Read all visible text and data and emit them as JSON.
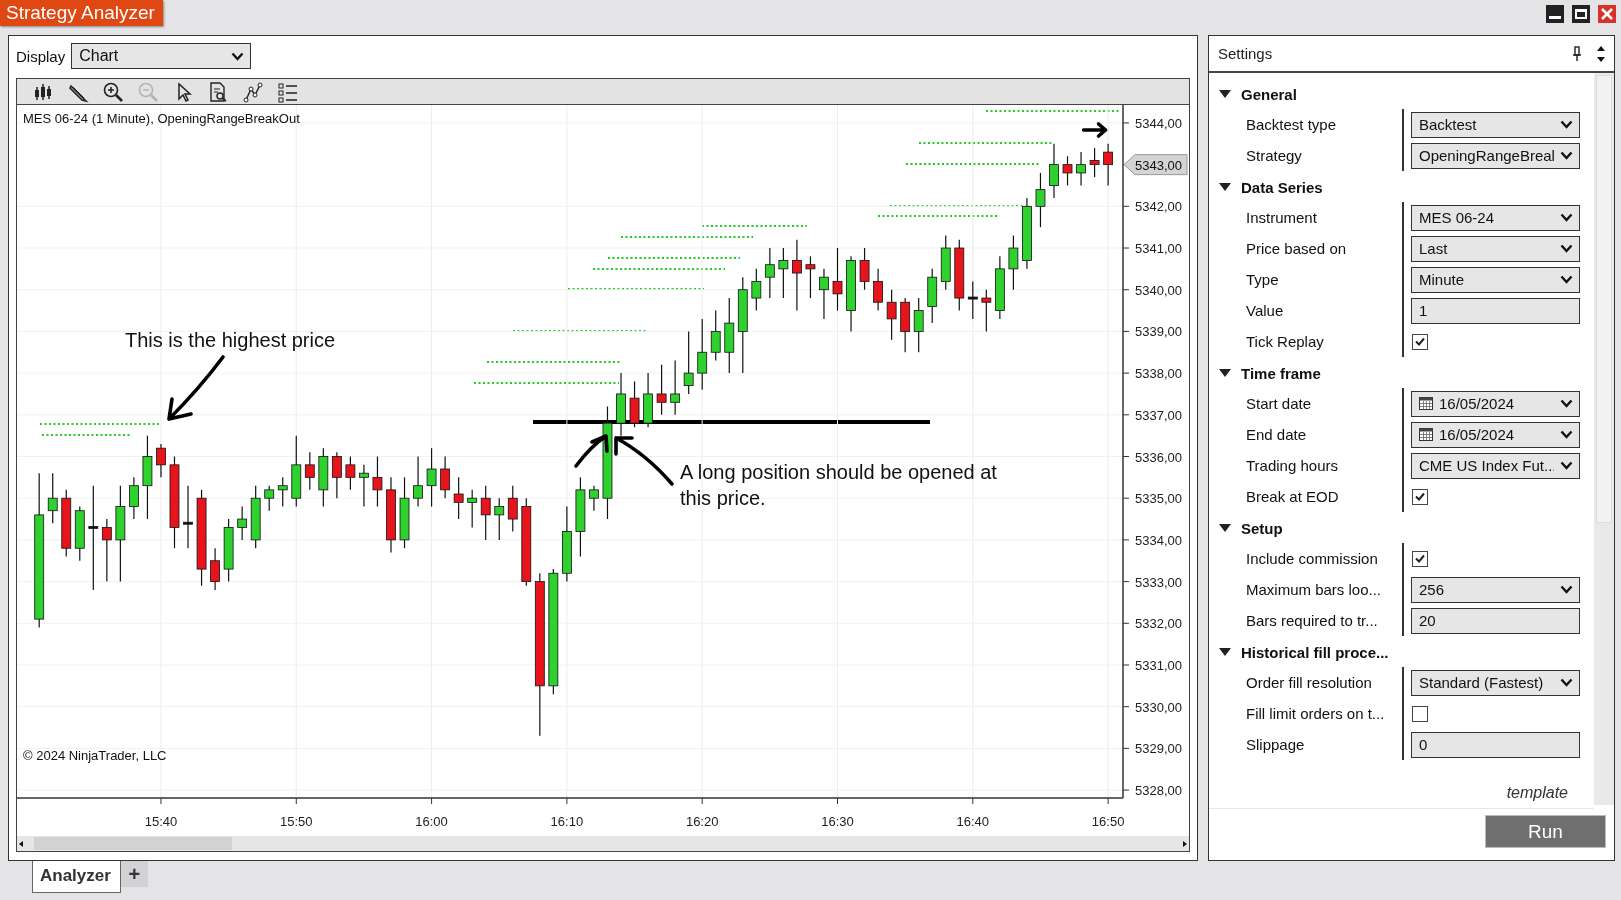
{
  "window": {
    "title": "Strategy Analyzer",
    "controls": [
      {
        "kind": "minimize"
      },
      {
        "kind": "maximize"
      },
      {
        "kind": "close"
      }
    ]
  },
  "display": {
    "label": "Display",
    "value": "Chart"
  },
  "toolbar": [
    {
      "kind": "bars",
      "disabled": false
    },
    {
      "kind": "pencil",
      "disabled": false
    },
    {
      "kind": "zoom-in",
      "disabled": false
    },
    {
      "kind": "zoom-out",
      "disabled": true
    },
    {
      "kind": "pointer",
      "disabled": false
    },
    {
      "kind": "properties",
      "disabled": false
    },
    {
      "kind": "drawing-tool",
      "disabled": false
    },
    {
      "kind": "list",
      "disabled": false
    }
  ],
  "chart": {
    "copyright": "© 2024 NinjaTrader, LLC",
    "last_price": "5343,00",
    "chart_data": {
      "type": "candlestick",
      "title": "MES 06-24 (1 Minute), OpeningRangeBreakOut",
      "grid": true,
      "x": [
        931,
        932,
        933,
        934,
        935,
        936,
        937,
        938,
        939,
        940,
        941,
        942,
        943,
        944,
        945,
        946,
        947,
        948,
        949,
        950,
        951,
        952,
        953,
        954,
        955,
        956,
        957,
        958,
        959,
        960,
        961,
        962,
        963,
        964,
        965,
        966,
        967,
        968,
        969,
        970,
        971,
        972,
        973,
        974,
        975,
        976,
        977,
        978,
        979,
        980,
        981,
        982,
        983,
        984,
        985,
        986,
        987,
        988,
        989,
        990,
        991,
        992,
        993,
        994,
        995,
        996,
        997,
        998,
        999,
        1000,
        1001,
        1002,
        1003,
        1004,
        1005,
        1006,
        1007,
        1008,
        1009,
        1010
      ],
      "ohlc": [
        [
          5332.1,
          5335.6,
          5331.9,
          5334.6
        ],
        [
          5334.7,
          5335.6,
          5334.4,
          5335.0
        ],
        [
          5335.0,
          5335.2,
          5333.6,
          5333.8
        ],
        [
          5333.8,
          5334.8,
          5333.5,
          5334.7
        ],
        [
          5334.3,
          5335.3,
          5332.8,
          5334.3
        ],
        [
          5334.3,
          5334.5,
          5333.0,
          5334.0
        ],
        [
          5334.0,
          5335.3,
          5333.0,
          5334.8
        ],
        [
          5334.8,
          5335.5,
          5334.5,
          5335.3
        ],
        [
          5335.3,
          5336.5,
          5334.5,
          5336.0
        ],
        [
          5336.2,
          5336.3,
          5335.5,
          5335.8
        ],
        [
          5335.8,
          5336.0,
          5333.8,
          5334.3
        ],
        [
          5334.4,
          5335.3,
          5333.8,
          5334.4
        ],
        [
          5335.0,
          5335.2,
          5332.9,
          5333.3
        ],
        [
          5333.5,
          5333.8,
          5332.8,
          5333.0
        ],
        [
          5333.3,
          5334.5,
          5333.0,
          5334.3
        ],
        [
          5334.3,
          5334.8,
          5334.0,
          5334.5
        ],
        [
          5334.0,
          5335.3,
          5333.8,
          5335.0
        ],
        [
          5335.0,
          5335.3,
          5334.7,
          5335.2
        ],
        [
          5335.2,
          5335.5,
          5334.8,
          5335.3
        ],
        [
          5335.0,
          5336.5,
          5334.8,
          5335.8
        ],
        [
          5335.8,
          5336.1,
          5335.2,
          5335.5
        ],
        [
          5335.2,
          5336.2,
          5334.8,
          5336.0
        ],
        [
          5336.0,
          5336.1,
          5335.0,
          5335.5
        ],
        [
          5335.8,
          5336.0,
          5335.2,
          5335.5
        ],
        [
          5335.5,
          5335.8,
          5334.8,
          5335.6
        ],
        [
          5335.5,
          5336.0,
          5334.8,
          5335.2
        ],
        [
          5335.2,
          5335.5,
          5333.7,
          5334.0
        ],
        [
          5334.0,
          5335.5,
          5333.8,
          5335.0
        ],
        [
          5335.0,
          5336.0,
          5334.8,
          5335.3
        ],
        [
          5335.3,
          5336.2,
          5334.8,
          5335.7
        ],
        [
          5335.7,
          5336.0,
          5335.0,
          5335.2
        ],
        [
          5335.1,
          5335.5,
          5334.5,
          5334.9
        ],
        [
          5334.9,
          5335.2,
          5334.3,
          5335.0
        ],
        [
          5335.0,
          5335.3,
          5334.0,
          5334.6
        ],
        [
          5334.6,
          5335.0,
          5334.0,
          5334.8
        ],
        [
          5335.0,
          5335.3,
          5334.2,
          5334.5
        ],
        [
          5334.8,
          5335.0,
          5332.9,
          5333.0
        ],
        [
          5333.0,
          5333.2,
          5329.3,
          5330.5
        ],
        [
          5330.5,
          5333.3,
          5330.3,
          5333.2
        ],
        [
          5333.2,
          5334.8,
          5333.0,
          5334.2
        ],
        [
          5334.2,
          5335.5,
          5333.6,
          5335.2
        ],
        [
          5335.0,
          5335.3,
          5334.7,
          5335.2
        ],
        [
          5335.0,
          5337.2,
          5334.5,
          5336.8
        ],
        [
          5336.8,
          5338.0,
          5336.5,
          5337.5
        ],
        [
          5337.4,
          5337.8,
          5336.7,
          5336.8
        ],
        [
          5336.8,
          5338.0,
          5336.7,
          5337.5
        ],
        [
          5337.5,
          5338.2,
          5337.0,
          5337.3
        ],
        [
          5337.3,
          5338.3,
          5337.0,
          5337.5
        ],
        [
          5337.7,
          5339.0,
          5337.5,
          5338.0
        ],
        [
          5338.0,
          5339.3,
          5337.6,
          5338.5
        ],
        [
          5338.5,
          5339.5,
          5338.3,
          5339.0
        ],
        [
          5338.5,
          5339.8,
          5338.0,
          5339.2
        ],
        [
          5339.0,
          5340.3,
          5338.0,
          5340.0
        ],
        [
          5339.8,
          5340.5,
          5339.5,
          5340.2
        ],
        [
          5340.3,
          5341.0,
          5339.8,
          5340.6
        ],
        [
          5340.5,
          5341.0,
          5339.8,
          5340.7
        ],
        [
          5340.7,
          5341.2,
          5339.5,
          5340.4
        ],
        [
          5340.6,
          5340.8,
          5339.8,
          5340.5
        ],
        [
          5340.0,
          5340.5,
          5339.3,
          5340.3
        ],
        [
          5340.2,
          5341.0,
          5339.5,
          5339.9
        ],
        [
          5339.5,
          5340.8,
          5339.0,
          5340.7
        ],
        [
          5340.7,
          5341.0,
          5340.0,
          5340.2
        ],
        [
          5340.2,
          5340.5,
          5339.5,
          5339.7
        ],
        [
          5339.7,
          5340.0,
          5338.8,
          5339.3
        ],
        [
          5339.7,
          5339.8,
          5338.5,
          5339.0
        ],
        [
          5339.0,
          5339.8,
          5338.5,
          5339.5
        ],
        [
          5339.6,
          5340.5,
          5339.2,
          5340.3
        ],
        [
          5340.2,
          5341.3,
          5340.0,
          5341.0
        ],
        [
          5341.0,
          5341.2,
          5339.5,
          5339.8
        ],
        [
          5339.8,
          5340.2,
          5339.3,
          5339.8
        ],
        [
          5339.8,
          5340.0,
          5339.0,
          5339.7
        ],
        [
          5339.5,
          5340.8,
          5339.3,
          5340.5
        ],
        [
          5340.5,
          5341.3,
          5340.0,
          5341.0
        ],
        [
          5340.7,
          5342.2,
          5340.5,
          5342.0
        ],
        [
          5342.0,
          5342.8,
          5341.5,
          5342.4
        ],
        [
          5342.5,
          5343.5,
          5342.2,
          5343.0
        ],
        [
          5343.0,
          5343.2,
          5342.5,
          5342.8
        ],
        [
          5342.8,
          5343.3,
          5342.5,
          5343.0
        ],
        [
          5343.1,
          5343.4,
          5342.7,
          5343.0
        ],
        [
          5343.3,
          5343.5,
          5342.5,
          5343.0
        ]
      ],
      "xlim": [
        929.36,
        1011.1
      ],
      "ylim": [
        5327.81,
        5344.43
      ],
      "xticks": [
        {
          "value": 940,
          "label": "15:40"
        },
        {
          "value": 950,
          "label": "15:50"
        },
        {
          "value": 960,
          "label": "16:00"
        },
        {
          "value": 970,
          "label": "16:10"
        },
        {
          "value": 980,
          "label": "16:20"
        },
        {
          "value": 990,
          "label": "16:30"
        },
        {
          "value": 1000,
          "label": "16:40"
        },
        {
          "value": 1010,
          "label": "16:50"
        }
      ],
      "yticks": [
        {
          "value": 5344,
          "label": "5344,00"
        },
        {
          "value": 5342,
          "label": "5342,00"
        },
        {
          "value": 5341,
          "label": "5341,00"
        },
        {
          "value": 5340,
          "label": "5340,00"
        },
        {
          "value": 5339,
          "label": "5339,00"
        },
        {
          "value": 5338,
          "label": "5338,00"
        },
        {
          "value": 5337,
          "label": "5337,00"
        },
        {
          "value": 5336,
          "label": "5336,00"
        },
        {
          "value": 5335,
          "label": "5335,00"
        },
        {
          "value": 5334,
          "label": "5334,00"
        },
        {
          "value": 5333,
          "label": "5333,00"
        },
        {
          "value": 5332,
          "label": "5332,00"
        },
        {
          "value": 5331,
          "label": "5331,00"
        },
        {
          "value": 5330,
          "label": "5330,00"
        },
        {
          "value": 5329,
          "label": "5329,00"
        },
        {
          "value": 5328,
          "label": "5328,00"
        }
      ],
      "annotations": [
        "This is the highest price",
        "A long position should be opened at this price."
      ]
    }
  },
  "tabs": [
    {
      "label": "Analyzer",
      "selected": true
    }
  ],
  "add_tab": "+",
  "settings": {
    "title": "Settings",
    "categories": [
      {
        "title": "General",
        "expanded": true,
        "properties": [
          {
            "label": "Backtest type",
            "kind": "dropdown",
            "value": "Backtest"
          },
          {
            "label": "Strategy",
            "kind": "dropdown",
            "value": "OpeningRangeBreal"
          }
        ]
      },
      {
        "title": "Data Series",
        "expanded": true,
        "properties": [
          {
            "label": "Instrument",
            "kind": "dropdown",
            "value": "MES 06-24"
          },
          {
            "label": "Price based on",
            "kind": "dropdown",
            "value": "Last"
          },
          {
            "label": "Type",
            "kind": "dropdown",
            "value": "Minute"
          },
          {
            "label": "Value",
            "kind": "text",
            "value": "1"
          },
          {
            "label": "Tick Replay",
            "kind": "checkbox",
            "checked": true
          }
        ]
      },
      {
        "title": "Time frame",
        "expanded": true,
        "properties": [
          {
            "label": "Start date",
            "kind": "date",
            "value": "16/05/2024"
          },
          {
            "label": "End date",
            "kind": "date",
            "value": "16/05/2024"
          },
          {
            "label": "Trading hours",
            "kind": "dropdown",
            "value": "CME US Index Fut..."
          },
          {
            "label": "Break at EOD",
            "kind": "checkbox",
            "checked": true
          }
        ]
      },
      {
        "title": "Setup",
        "expanded": true,
        "properties": [
          {
            "label": "Include commission",
            "kind": "checkbox",
            "checked": true
          },
          {
            "label": "Maximum bars loo...",
            "kind": "dropdown",
            "value": "256"
          },
          {
            "label": "Bars required to tr...",
            "kind": "text",
            "value": "20"
          }
        ]
      },
      {
        "title": "Historical fill proce...",
        "expanded": true,
        "properties": [
          {
            "label": "Order fill resolution",
            "kind": "dropdown",
            "value": "Standard (Fastest)"
          },
          {
            "label": "Fill limit orders on t...",
            "kind": "checkbox",
            "checked": false
          },
          {
            "label": "Slippage",
            "kind": "text",
            "value": "0"
          }
        ]
      }
    ],
    "template": "template",
    "run_button": "Run"
  }
}
